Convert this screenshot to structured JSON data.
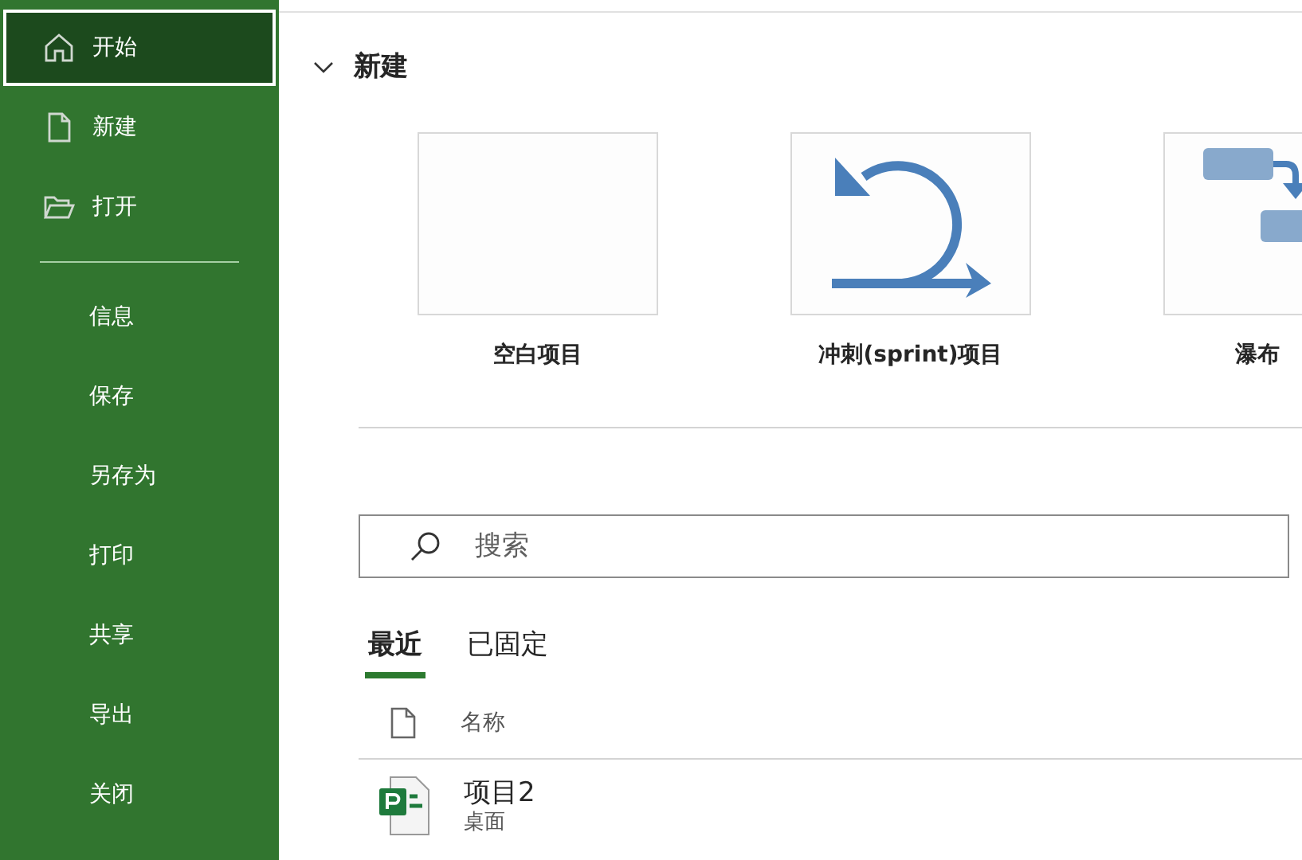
{
  "sidebar": {
    "primary_items": [
      {
        "label": "开始",
        "selected": true
      },
      {
        "label": "新建",
        "selected": false
      },
      {
        "label": "打开",
        "selected": false
      }
    ],
    "secondary_items": [
      {
        "label": "信息",
        "selected": false
      },
      {
        "label": "保存",
        "selected": false
      },
      {
        "label": "另存为",
        "selected": false
      },
      {
        "label": "打印",
        "selected": false
      },
      {
        "label": "共享",
        "selected": false
      },
      {
        "label": "导出",
        "selected": false
      },
      {
        "label": "关闭",
        "selected": false
      }
    ]
  },
  "new_section": {
    "title": "新建",
    "expanded": true,
    "templates": [
      {
        "label": "空白项目"
      },
      {
        "label": "冲刺(sprint)项目"
      },
      {
        "label": "瀑布"
      }
    ]
  },
  "search": {
    "placeholder": "搜索"
  },
  "tabs": [
    {
      "label": "最近",
      "selected": true
    },
    {
      "label": "已固定",
      "selected": false
    }
  ],
  "file_list": {
    "columns": [
      "名称"
    ],
    "rows": [
      {
        "name": "项目2",
        "location": "桌面"
      }
    ]
  }
}
